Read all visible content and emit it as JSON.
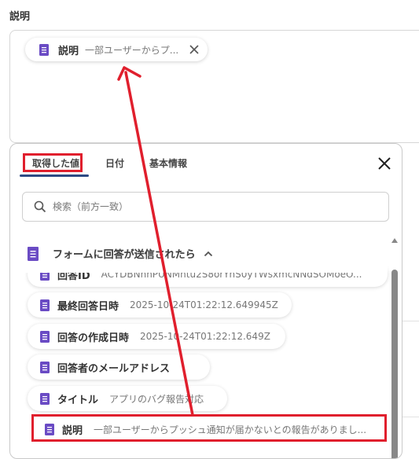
{
  "field": {
    "label": "説明",
    "chip": {
      "label": "説明",
      "value": "一部ユーザーからプ..."
    }
  },
  "panel": {
    "tabs": [
      {
        "label": "取得した値",
        "active": true
      },
      {
        "label": "日付",
        "active": false
      },
      {
        "label": "基本情報",
        "active": false
      }
    ],
    "search_placeholder": "検索（前方一致）",
    "group_title": "フォームに回答が送信されたら",
    "items": [
      {
        "label": "回答ID",
        "value": "ACYDBNhhPUNMntu2S8orYnS0yTWsxmcNNdSOMoeO..."
      },
      {
        "label": "最終回答日時",
        "value": "2025-10-24T01:22:12.649945Z"
      },
      {
        "label": "回答の作成日時",
        "value": "2025-10-24T01:22:12.649Z"
      },
      {
        "label": "回答者のメールアドレス",
        "value": ""
      },
      {
        "label": "タイトル",
        "value": "アプリのバグ報告対応"
      },
      {
        "label": "説明",
        "value": "一部ユーザーからプッシュ通知が届かないとの報告がありまし..."
      }
    ]
  },
  "colors": {
    "highlight": "#e01f2d",
    "icon": "#6a4bc4",
    "tab_underline": "#2d4a84"
  }
}
